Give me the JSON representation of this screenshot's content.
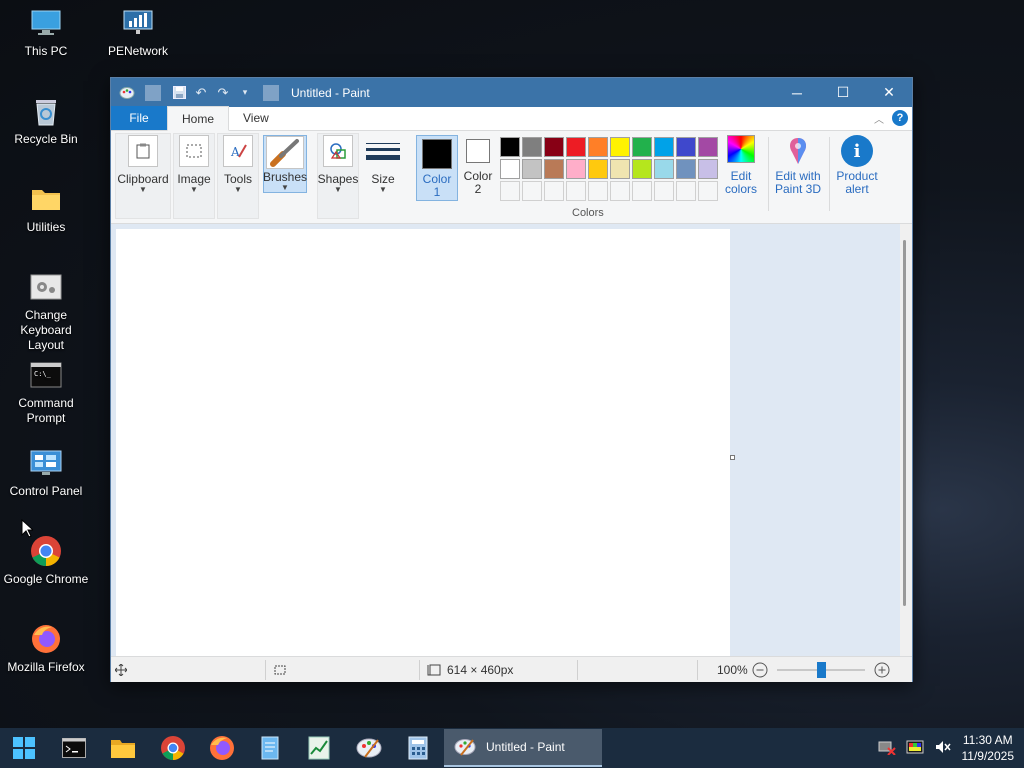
{
  "desktop": {
    "icons": [
      {
        "label": "This PC"
      },
      {
        "label": "PENetwork"
      },
      {
        "label": "Recycle Bin"
      },
      {
        "label": "Utilities"
      },
      {
        "label": "Change Keyboard Layout"
      },
      {
        "label": "Command Prompt"
      },
      {
        "label": "Control Panel"
      },
      {
        "label": "Google Chrome"
      },
      {
        "label": "Mozilla Firefox"
      }
    ]
  },
  "paint": {
    "title": "Untitled - Paint",
    "tabs": {
      "file": "File",
      "home": "Home",
      "view": "View"
    },
    "help": "?",
    "ribbon": {
      "clipboard": "Clipboard",
      "image": "Image",
      "tools": "Tools",
      "brushes": "Brushes",
      "shapes": "Shapes",
      "size": "Size",
      "color1_a": "Color",
      "color1_b": "1",
      "color2_a": "Color",
      "color2_b": "2",
      "colors_label": "Colors",
      "edit_colors_a": "Edit",
      "edit_colors_b": "colors",
      "edit_paint3d_a": "Edit with",
      "edit_paint3d_b": "Paint 3D",
      "product_alert_a": "Product",
      "product_alert_b": "alert"
    },
    "palette": {
      "row1": [
        "#000000",
        "#7f7f7f",
        "#880015",
        "#ed1c24",
        "#ff7f27",
        "#fff200",
        "#22b14c",
        "#00a2e8",
        "#3f48cc",
        "#a349a4"
      ],
      "row2": [
        "#ffffff",
        "#c3c3c3",
        "#b97a57",
        "#ffaec9",
        "#ffc90e",
        "#efe4b0",
        "#b5e61d",
        "#99d9ea",
        "#7092be",
        "#c8bfe7"
      ]
    },
    "status": {
      "canvas_size": "614 × 460px",
      "zoom": "100%"
    }
  },
  "taskbar": {
    "active_app": "Untitled - Paint",
    "time": "11:30 AM",
    "date": "11/9/2025"
  }
}
